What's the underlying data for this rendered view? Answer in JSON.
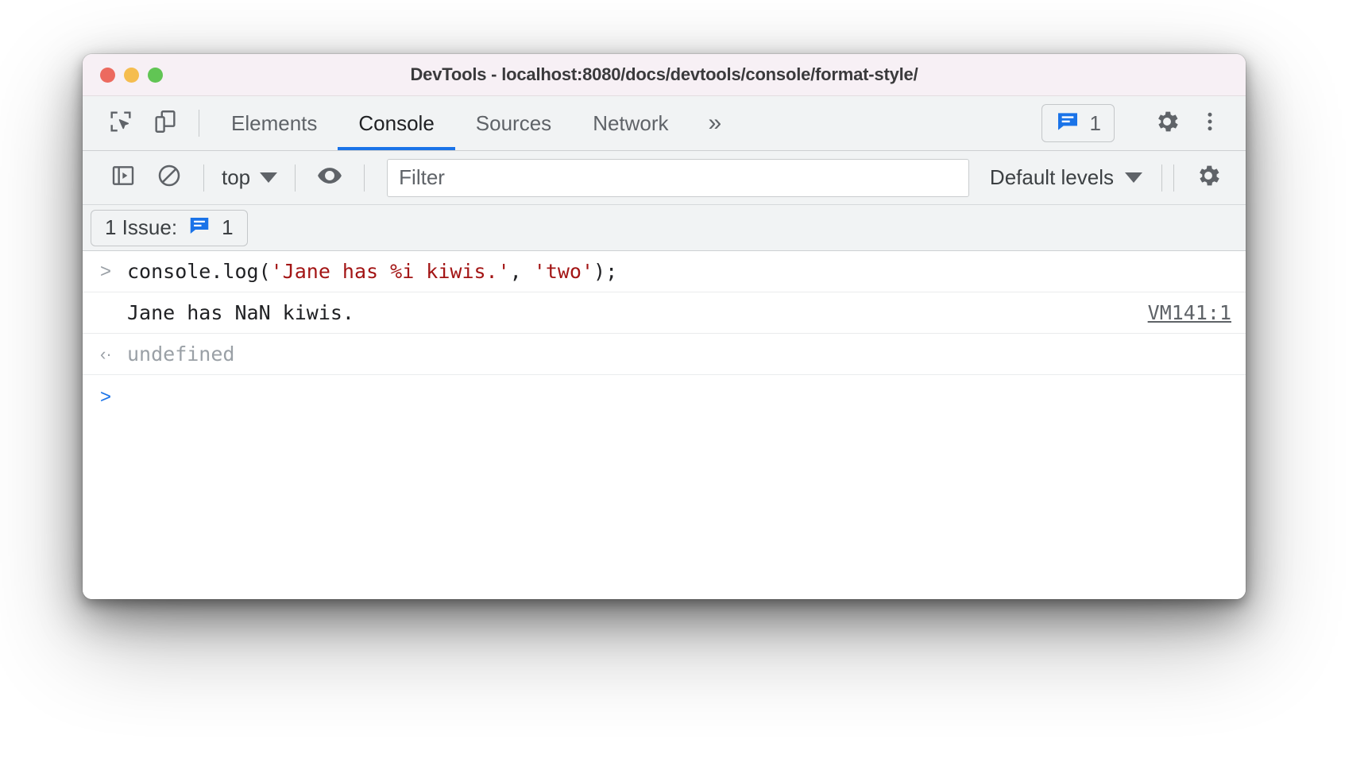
{
  "window": {
    "title": "DevTools - localhost:8080/docs/devtools/console/format-style/",
    "traffic_lights": [
      "close",
      "minimize",
      "zoom"
    ]
  },
  "main_toolbar": {
    "inspect_icon": "inspect-element-icon",
    "device_icon": "device-toolbar-icon",
    "tabs": [
      {
        "label": "Elements",
        "active": false
      },
      {
        "label": "Console",
        "active": true
      },
      {
        "label": "Sources",
        "active": false
      },
      {
        "label": "Network",
        "active": false
      }
    ],
    "more_tabs_label": "»",
    "issues_badge": {
      "icon": "issues-message-icon",
      "count": "1",
      "accent": "#1a73e8"
    },
    "settings_icon": "gear-icon",
    "more_options_icon": "kebab-menu-icon"
  },
  "console_toolbar": {
    "sidebar_toggle_icon": "console-sidebar-icon",
    "clear_console_icon": "clear-console-icon",
    "context_selector": {
      "label": "top",
      "caret": "chevron-down-icon"
    },
    "live_expression_icon": "eye-icon",
    "filter": {
      "placeholder": "Filter",
      "value": ""
    },
    "log_levels": {
      "label": "Default levels",
      "caret": "chevron-down-icon"
    },
    "settings_icon": "gear-icon"
  },
  "issue_bar": {
    "label": "1 Issue:",
    "icon": "issues-message-icon",
    "count": "1"
  },
  "console": {
    "rows": [
      {
        "type": "input",
        "gutter": ">",
        "segments": [
          {
            "text": "console.log(",
            "kind": "plain"
          },
          {
            "text": "'Jane has %i kiwis.'",
            "kind": "string"
          },
          {
            "text": ", ",
            "kind": "plain"
          },
          {
            "text": "'two'",
            "kind": "string"
          },
          {
            "text": ");",
            "kind": "plain"
          }
        ]
      },
      {
        "type": "output",
        "gutter": "",
        "text": "Jane has NaN kiwis.",
        "source_link": "VM141:1"
      },
      {
        "type": "result",
        "gutter": "‹·",
        "text": "undefined"
      },
      {
        "type": "prompt",
        "gutter": ">",
        "text": ""
      }
    ]
  },
  "colors": {
    "accent_blue": "#1a73e8",
    "string_red": "#a31515",
    "titlebar_bg": "#f7f0f5",
    "toolbar_bg": "#f1f3f4"
  }
}
